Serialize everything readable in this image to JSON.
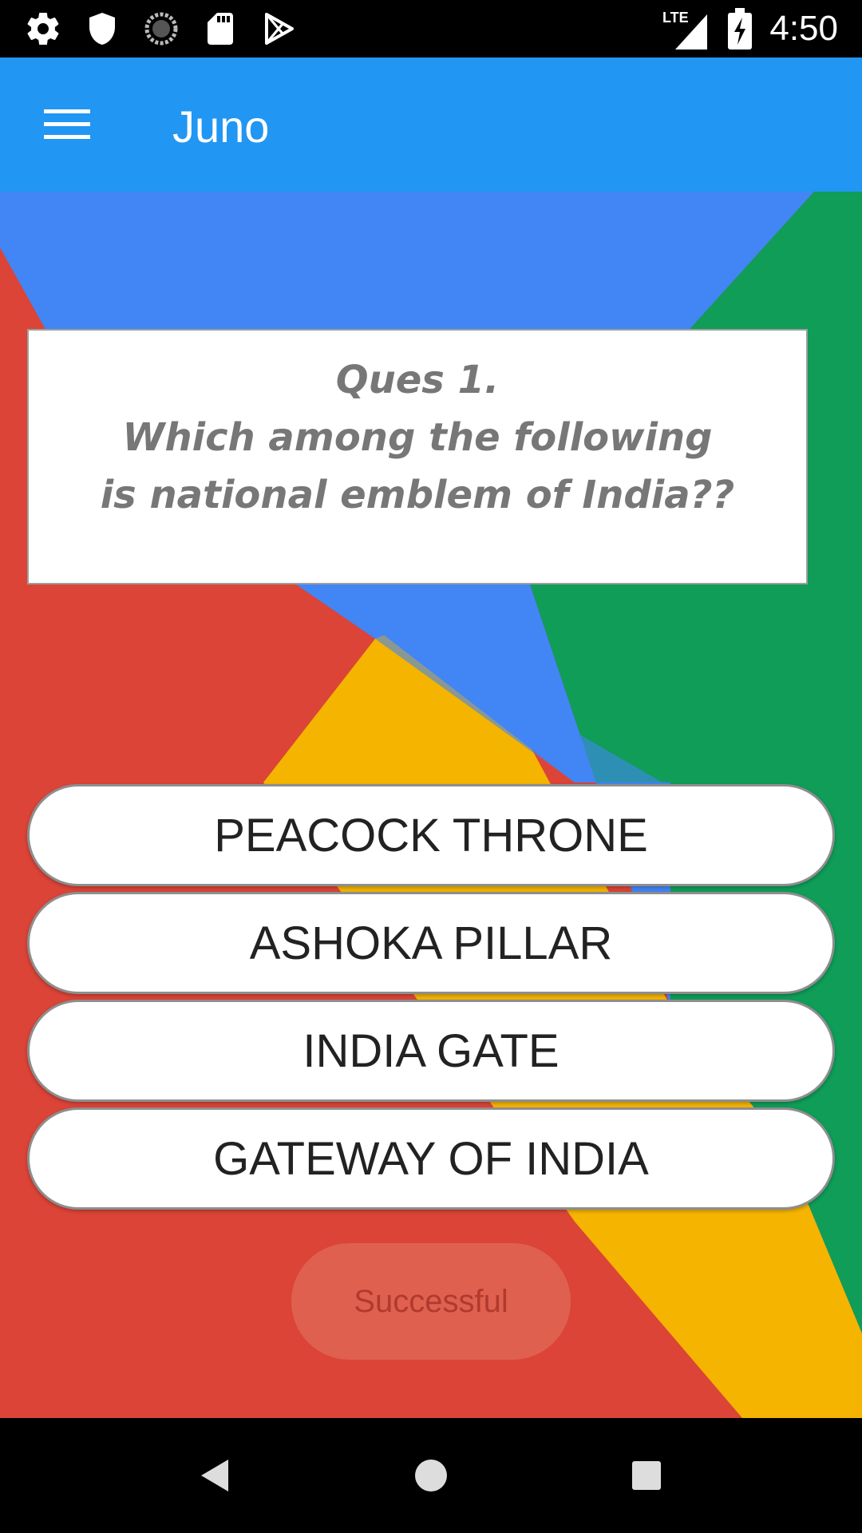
{
  "status_bar": {
    "time": "4:50",
    "network": "LTE",
    "left_icons": [
      "settings-icon",
      "shield-icon",
      "sync-icon",
      "sd-card-icon",
      "play-store-icon"
    ],
    "right_icons": [
      "signal-icon",
      "battery-charging-icon"
    ]
  },
  "app_bar": {
    "title": "Juno",
    "menu_icon": "hamburger-menu-icon",
    "color": "#2196F3"
  },
  "question": {
    "number_label": "Ques 1.",
    "line1": "Which among the following",
    "line2": "is national emblem of India??"
  },
  "options": [
    {
      "label": "PEACOCK THRONE"
    },
    {
      "label": "ASHOKA PILLAR"
    },
    {
      "label": "INDIA GATE"
    },
    {
      "label": "GATEWAY OF INDIA"
    }
  ],
  "status_button": {
    "label": "Successful"
  },
  "nav_bar": {
    "icons": [
      "back-icon",
      "home-icon",
      "recents-icon"
    ]
  },
  "colors": {
    "red": "#DB4437",
    "blue": "#4285F4",
    "green": "#0F9D58",
    "yellow": "#F4B400"
  }
}
